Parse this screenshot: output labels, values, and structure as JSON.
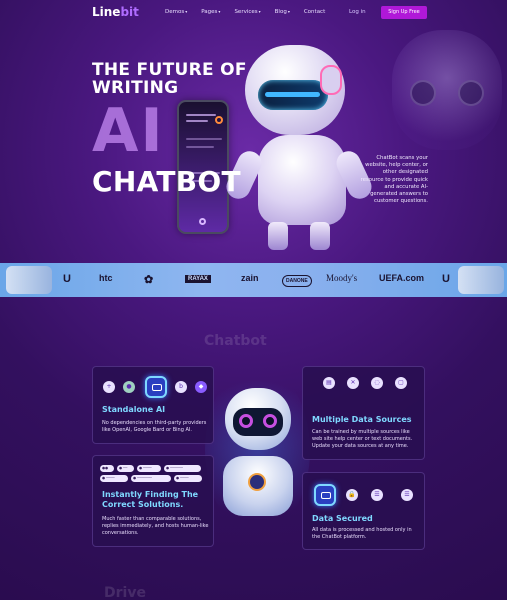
{
  "nav": {
    "logo_main": "Line",
    "logo_accent": "bit",
    "items": [
      "Demos",
      "Pages",
      "Services",
      "Blog",
      "Contact"
    ],
    "login": "Log in",
    "signup": "Sign Up Free"
  },
  "hero": {
    "line1": "THE FUTURE OF",
    "line2": "WRITING",
    "big": "AI",
    "line3": "CHATBOT",
    "description": "ChatBot scans your website, help center, or other designated resource to provide quick and accurate AI-generated answers to customer questions."
  },
  "brands": [
    "htc",
    "RAYAX",
    "zain",
    "DANONE",
    "Moody's",
    "UEFA.com"
  ],
  "section_watermark": "Chatbot",
  "bottom_watermark": "Drive",
  "features": {
    "standalone": {
      "title": "Standalone AI",
      "text": "No dependencies on third-party providers like OpenAI, Google Bard or Bing AI."
    },
    "multiple": {
      "title": "Multiple Data Sources",
      "text": "Can be trained by multiple sources like web site help center or text documents. Update your data sources at any time."
    },
    "instant": {
      "title": "Instantly Finding The Correct Solutions.",
      "text": "Much faster than comparable solutions, replies immediately, and hosts human-like conversations."
    },
    "secured": {
      "title": "Data Secured",
      "text": "All data is processed and hosted only in the ChatBot platform."
    }
  },
  "colors": {
    "accent": "#b018d8",
    "card_title": "#7fd8ff",
    "bg": "#33105f"
  }
}
